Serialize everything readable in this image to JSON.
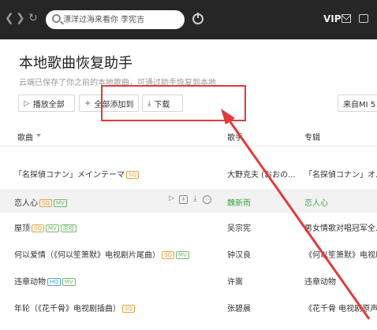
{
  "titlebar": {
    "back_icon": "chevron-left-icon",
    "forward_icon": "chevron-right-icon",
    "refresh_icon": "refresh-icon",
    "search": {
      "placeholder": "漂洋过海来看你 李宪吉"
    },
    "vip_label": "VIP"
  },
  "page": {
    "title": "本地歌曲恢复助手",
    "subtitle": "云端已保存了你之前的本地歌曲，可通过助手恢复到本地"
  },
  "toolbar": {
    "play_all": "播放全部",
    "add_all": "全部添加到",
    "download": "下载",
    "source": "来自MI 5"
  },
  "table": {
    "headers": {
      "song": "歌曲",
      "singer": "歌手",
      "album": "专辑"
    },
    "rows": [
      {
        "song": "「名探偵コナン」メインテーマ",
        "tags": [
          "SQ"
        ],
        "singer": "大野克夫 (おおの...",
        "album": "「名探偵コナン」オ..."
      },
      {
        "song": "恋人心",
        "tags": [
          "SQ",
          "MV"
        ],
        "singer": "魏新雨",
        "album": "恋人心",
        "highlight": true
      },
      {
        "song": "屋顶",
        "tags": [
          "SQ",
          "MV",
          "original"
        ],
        "singer": "吴宗宪",
        "album": "男女情歌对唱冠军全..."
      },
      {
        "song": "何以爱情（《何以笙箫默》电视剧片尾曲）",
        "tags": [
          "SQ",
          "MV"
        ],
        "singer": "钟汉良",
        "album": "《何以笙箫默》电视原..."
      },
      {
        "song": "违章动物",
        "tags": [
          "HQ",
          "MV"
        ],
        "singer": "许嵩",
        "album": "违章动物"
      },
      {
        "song": "年轮（《花千骨》电视剧插曲）",
        "tags": [
          "SQ"
        ],
        "singer": "张碧晨",
        "album": "《花千骨 电视剧原声带..."
      }
    ],
    "tag_labels": {
      "SQ": "SQ",
      "HQ": "HQ",
      "MV": "MV",
      "original": "原唱"
    }
  },
  "colors": {
    "titlebar_bg": "#262626",
    "highlight_green": "#3ea545",
    "annotation_red": "#e03b3b",
    "sq_tag": "#e6a23c",
    "mv_tag": "#6fb96a"
  }
}
